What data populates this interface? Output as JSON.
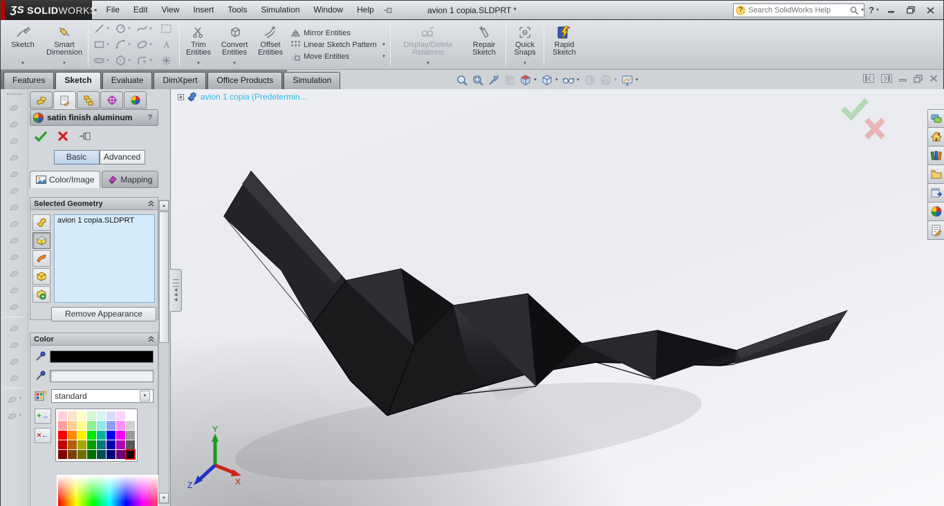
{
  "titlebar": {
    "logo_mark": "ƷS",
    "logo_text1": "SOLID",
    "logo_text2": "WORKS",
    "menus": [
      "File",
      "Edit",
      "View",
      "Insert",
      "Tools",
      "Simulation",
      "Window",
      "Help"
    ],
    "doc_title": "avion 1 copia.SLDPRT *",
    "search_placeholder": "Search SolidWorks Help"
  },
  "ribbon": {
    "sketch": "Sketch",
    "smart_dimension": "Smart Dimension",
    "trim": "Trim Entities",
    "convert": "Convert Entities",
    "offset": "Offset Entities",
    "mirror": "Mirror Entities",
    "linear_pattern": "Linear Sketch Pattern",
    "move": "Move Entities",
    "display_delete": "Display/Delete Relations",
    "repair": "Repair Sketch",
    "quick_snaps": "Quick Snaps",
    "rapid_sketch": "Rapid Sketch",
    "entity_tools": [
      {
        "name": "line-icon",
        "dd": true
      },
      {
        "name": "circle-icon",
        "dd": true
      },
      {
        "name": "spline-icon",
        "dd": true
      },
      {
        "name": "sketch-picture-icon",
        "dd": false
      },
      {
        "name": "rectangle-icon",
        "dd": true
      },
      {
        "name": "arc-icon",
        "dd": true
      },
      {
        "name": "ellipse-icon",
        "dd": true
      },
      {
        "name": "text-icon",
        "dd": false
      },
      {
        "name": "slot-icon",
        "dd": true
      },
      {
        "name": "polygon-icon",
        "dd": true
      },
      {
        "name": "sketch-fillet-icon",
        "dd": true
      },
      {
        "name": "point-icon",
        "dd": false
      }
    ]
  },
  "command_tabs": {
    "items": [
      {
        "label": "Features",
        "active": false
      },
      {
        "label": "Sketch",
        "active": true
      },
      {
        "label": "Evaluate",
        "active": false
      },
      {
        "label": "DimXpert",
        "active": false
      },
      {
        "label": "Office Products",
        "active": false
      },
      {
        "label": "Simulation",
        "active": false
      }
    ]
  },
  "headsup": {
    "items": [
      {
        "name": "zoom-to-fit-icon"
      },
      {
        "name": "zoom-to-area-icon"
      },
      {
        "name": "magnified-selection-icon"
      },
      {
        "name": "section-view-icon",
        "disabled": true
      },
      {
        "name": "view-orientation-icon",
        "dd": true
      },
      {
        "name": "display-style-icon",
        "dd": true
      },
      {
        "name": "hide-show-items-icon",
        "dd": true
      },
      {
        "name": "edit-appearance-icon",
        "disabled": true
      },
      {
        "name": "apply-scene-icon",
        "dd": true,
        "disabled": true
      },
      {
        "name": "view-settings-icon",
        "dd": true
      }
    ]
  },
  "left_toolbar": {
    "sections": [
      [
        "filled-surface-icon",
        "revolved-surface-icon",
        "swept-surface-icon",
        "lofted-surface-icon",
        "boundary-surface-icon",
        "offset-surface-icon",
        "planar-surface-icon",
        "extruded-surface-icon",
        "knit-surface-icon",
        "trim-surface-icon",
        "untrim-surface-icon",
        "extend-surface-icon",
        "delete-face-icon"
      ],
      [
        "move-face-icon",
        "replace-face-icon",
        "ruled-surface-icon",
        "freeform-icon"
      ],
      [
        "curve-tools-icon",
        "spline-tools-icon"
      ]
    ]
  },
  "property_manager": {
    "manager_tabs": [
      {
        "name": "feature-manager-tab-icon",
        "active": false
      },
      {
        "name": "property-manager-tab-icon",
        "active": true
      },
      {
        "name": "configuration-manager-tab-icon",
        "active": false
      },
      {
        "name": "dimxpert-manager-tab-icon",
        "active": false
      },
      {
        "name": "display-manager-tab-icon",
        "active": false
      }
    ],
    "title": "satin finish aluminum",
    "help_label": "?",
    "mode_basic": "Basic",
    "mode_advanced": "Advanced",
    "tab_color_image": "Color/Image",
    "tab_mapping": "Mapping",
    "selected_geometry": {
      "header": "Selected Geometry",
      "buttons": [
        {
          "name": "select-part-icon",
          "pressed": false
        },
        {
          "name": "select-body-icon",
          "pressed": true
        },
        {
          "name": "select-face-icon",
          "pressed": false
        },
        {
          "name": "select-surface-icon",
          "pressed": false
        },
        {
          "name": "select-feature-icon",
          "pressed": false
        }
      ],
      "items": [
        "avion 1 copia.SLDPRT"
      ],
      "remove_button": "Remove Appearance"
    },
    "color": {
      "header": "Color",
      "primary_swatch": "#000000",
      "secondary_swatch": "#eef0f2",
      "dropdown_value": "standard",
      "palette": [
        [
          "#ffd1dc",
          "#ffe3c8",
          "#ffffc8",
          "#d4f7d4",
          "#d2f5f5",
          "#d6defc",
          "#ffd2ff",
          "#ffffff"
        ],
        [
          "#ff9ea0",
          "#ffcf8e",
          "#ffff8e",
          "#8ef08e",
          "#8ee8e8",
          "#8e9ef8",
          "#ff8eff",
          "#cfcfcf"
        ],
        [
          "#f80000",
          "#ff8b00",
          "#fff000",
          "#00e800",
          "#00b4a0",
          "#0000f8",
          "#f800f8",
          "#9a9a9a"
        ],
        [
          "#c00000",
          "#b06000",
          "#a8a800",
          "#00a000",
          "#007878",
          "#0000b0",
          "#b000b0",
          "#585858"
        ],
        [
          "#800000",
          "#7a4200",
          "#6f6f00",
          "#006f00",
          "#004f4f",
          "#00007a",
          "#70006f",
          "#000000"
        ]
      ],
      "selected_cell": {
        "row": 4,
        "col": 7
      }
    }
  },
  "feature_tree": {
    "root": "avion 1 copia  (Predetermin..."
  },
  "task_pane": {
    "icons": [
      "solidworks-forum-icon",
      "solidworks-resources-icon",
      "design-library-icon",
      "file-explorer-icon",
      "view-palette-icon",
      "appearances-scenes-icon",
      "custom-properties-icon"
    ]
  },
  "triad": {
    "x": "X",
    "y": "Y",
    "z": "Z"
  },
  "colors": {
    "brand_red": "#cc0000",
    "selection_blue": "#d6ebfa",
    "tree_text": "#2cb8ec",
    "model_black": "#1a1a1c"
  }
}
